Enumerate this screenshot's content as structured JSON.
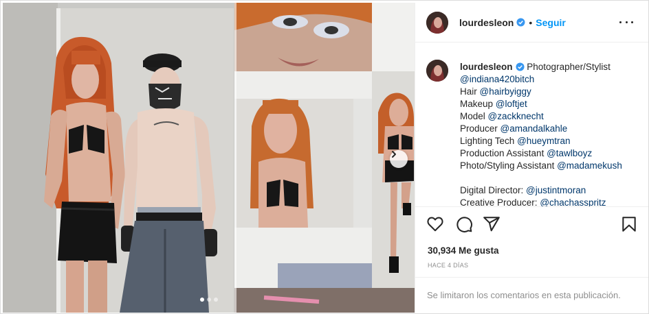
{
  "post": {
    "username": "lourdesleon",
    "separator": "•",
    "follow_label": "Seguir",
    "caption_lines": [
      {
        "parts": [
          {
            "t": "Photographer/Stylist",
            "m": false
          }
        ]
      },
      {
        "parts": [
          {
            "t": "@indiana420bitch",
            "m": true
          }
        ]
      },
      {
        "parts": [
          {
            "t": "Hair ",
            "m": false
          },
          {
            "t": "@hairbyiggy",
            "m": true
          }
        ]
      },
      {
        "parts": [
          {
            "t": "Makeup ",
            "m": false
          },
          {
            "t": "@loftjet",
            "m": true
          }
        ]
      },
      {
        "parts": [
          {
            "t": "Model ",
            "m": false
          },
          {
            "t": "@zackknecht",
            "m": true
          }
        ]
      },
      {
        "parts": [
          {
            "t": "Producer ",
            "m": false
          },
          {
            "t": "@amandalkahle",
            "m": true
          }
        ]
      },
      {
        "parts": [
          {
            "t": "Lighting Tech ",
            "m": false
          },
          {
            "t": "@hueymtran",
            "m": true
          }
        ]
      },
      {
        "parts": [
          {
            "t": "Production Assistant ",
            "m": false
          },
          {
            "t": "@tawlboyz",
            "m": true
          }
        ]
      },
      {
        "parts": [
          {
            "t": "Photo/Styling Assistant ",
            "m": false
          },
          {
            "t": "@madamekush",
            "m": true
          }
        ]
      },
      {
        "parts": []
      },
      {
        "parts": [
          {
            "t": "Digital Director: ",
            "m": false
          },
          {
            "t": "@justintmoran",
            "m": true
          }
        ]
      },
      {
        "parts": [
          {
            "t": "Creative Producer: ",
            "m": false
          },
          {
            "t": "@chachasspritz",
            "m": true
          }
        ]
      }
    ],
    "likes_text": "30,934 Me gusta",
    "time_text": "HACE 4 DÍAS",
    "comments_disabled_text": "Se limitaron los comentarios en esta publicación.",
    "carousel": {
      "count": 3,
      "active_index": 0
    }
  },
  "icons": {
    "verified": "verified-badge-icon",
    "more": "more-options-icon",
    "like": "heart-icon",
    "comment": "comment-icon",
    "share": "paper-plane-icon",
    "save": "bookmark-icon",
    "next": "chevron-right-icon"
  },
  "colors": {
    "link_blue": "#0095f6",
    "mention": "#00376b",
    "muted": "#8e8e8e",
    "text": "#262626",
    "verified": "#3897f0"
  }
}
